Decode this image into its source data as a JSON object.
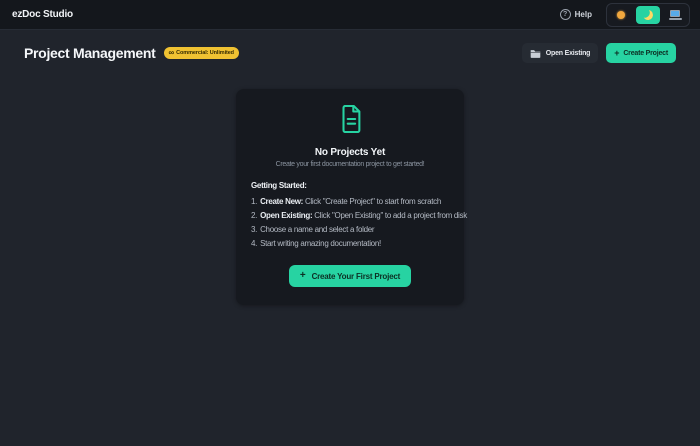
{
  "app": {
    "title": "ezDoc Studio"
  },
  "topbar": {
    "help_label": "Help"
  },
  "icons": {
    "help_glyph": "?",
    "plus_glyph": "+",
    "infinity_glyph": "∞"
  },
  "page": {
    "title": "Project Management",
    "badge_text": "Commercial: Unlimited",
    "open_existing_label": "Open Existing",
    "create_project_label": "Create Project"
  },
  "empty_state": {
    "title": "No Projects Yet",
    "subtitle": "Create your first documentation project to get started!",
    "getting_started_heading": "Getting Started:",
    "steps": [
      {
        "num": "1.",
        "bold": "Create New:",
        "text": " Click \"Create Project\" to start from scratch"
      },
      {
        "num": "2.",
        "bold": "Open Existing:",
        "text": " Click \"Open Existing\" to add a project from disk"
      },
      {
        "num": "3.",
        "bold": "",
        "text": "Choose a name and select a folder"
      },
      {
        "num": "4.",
        "bold": "",
        "text": "Start writing amazing documentation!"
      }
    ],
    "cta_label": "Create Your First Project"
  },
  "colors": {
    "accent": "#27d3a2",
    "badge_bg": "#f0c232",
    "sun": "#f0a73e",
    "moon": "#ffd964",
    "laptop_screen": "#58aae8"
  }
}
